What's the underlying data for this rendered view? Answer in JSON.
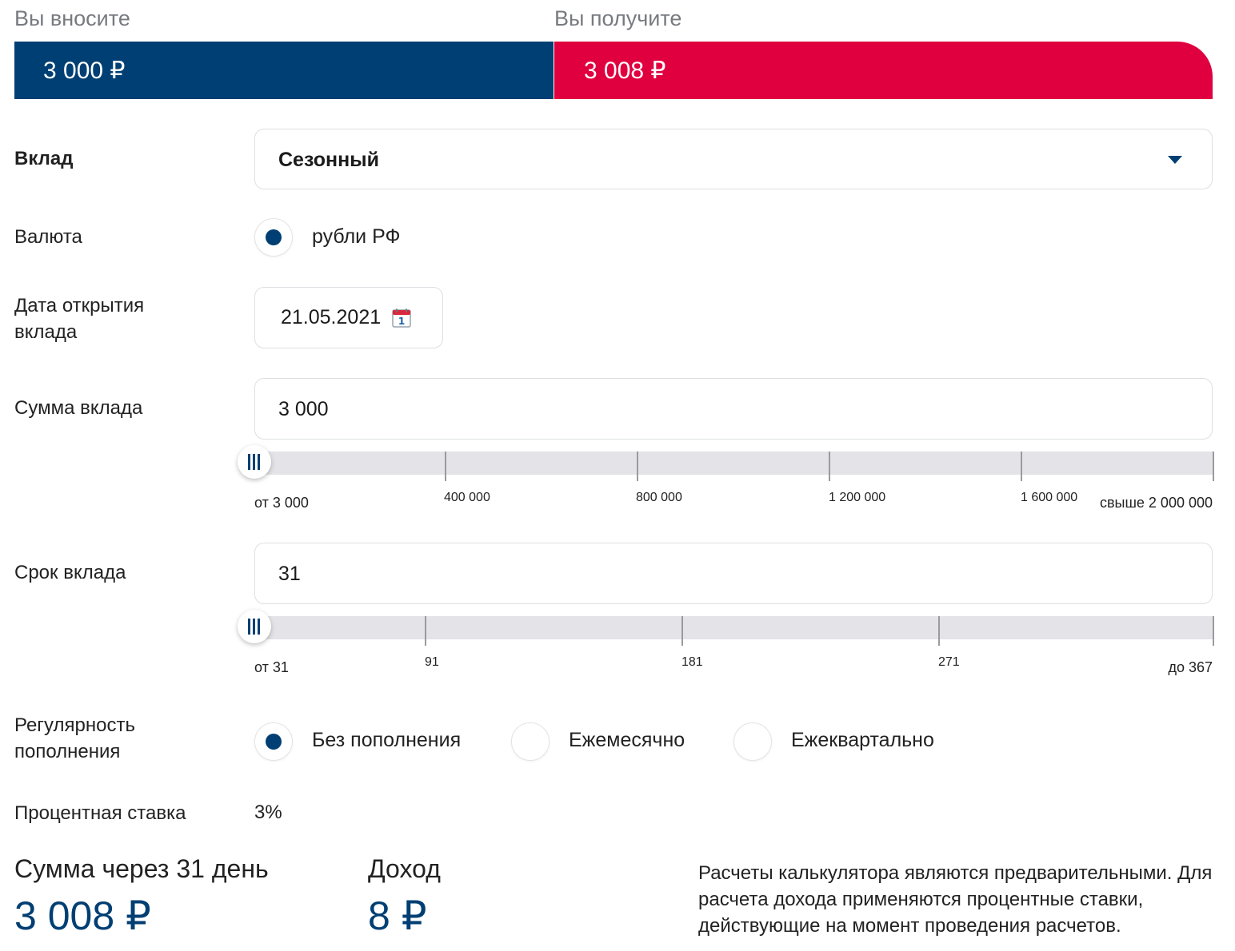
{
  "summary": {
    "deposit_label": "Вы вносите",
    "deposit_value": "3 000 ₽",
    "receive_label": "Вы получите",
    "receive_value": "3 008 ₽"
  },
  "deposit_type": {
    "label": "Вклад",
    "selected": "Сезонный",
    "icon": "caret-down-icon"
  },
  "currency": {
    "label": "Валюта",
    "options": [
      {
        "label": "рубли РФ",
        "selected": true
      }
    ]
  },
  "open_date": {
    "label": "Дата открытия вклада",
    "value": "21.05.2021",
    "calendar_day": "1",
    "icon": "calendar-icon"
  },
  "amount": {
    "label": "Сумма вклада",
    "value": "3 000",
    "slider_fraction": 0,
    "min_label": "от 3 000",
    "ticks": [
      "400 000",
      "800 000",
      "1 200 000",
      "1 600 000"
    ],
    "max_label": "свыше 2 000 000"
  },
  "term": {
    "label": "Срок вклада",
    "value": "31",
    "slider_fraction": 0,
    "min_label": "от 31",
    "ticks": [
      "91",
      "181",
      "271"
    ],
    "max_label": "до 367"
  },
  "replenishment": {
    "label": "Регулярность пополнения",
    "options": [
      {
        "label": "Без пополнения",
        "selected": true
      },
      {
        "label": "Ежемесячно",
        "selected": false
      },
      {
        "label": "Ежеквартально",
        "selected": false
      }
    ]
  },
  "rate": {
    "label": "Процентная ставка",
    "value": "3%"
  },
  "result": {
    "total_label": "Сумма через 31 день",
    "total_value": "3 008 ₽",
    "income_label": "Доход",
    "income_value": "8 ₽",
    "disclaimer": "Расчеты калькулятора являются предварительными. Для расчета дохода применяются процентные ставки, действующие на момент проведения расчетов."
  },
  "colors": {
    "primary_blue": "#003f73",
    "accent_red": "#e1003f",
    "track": "#e3e3e8"
  }
}
